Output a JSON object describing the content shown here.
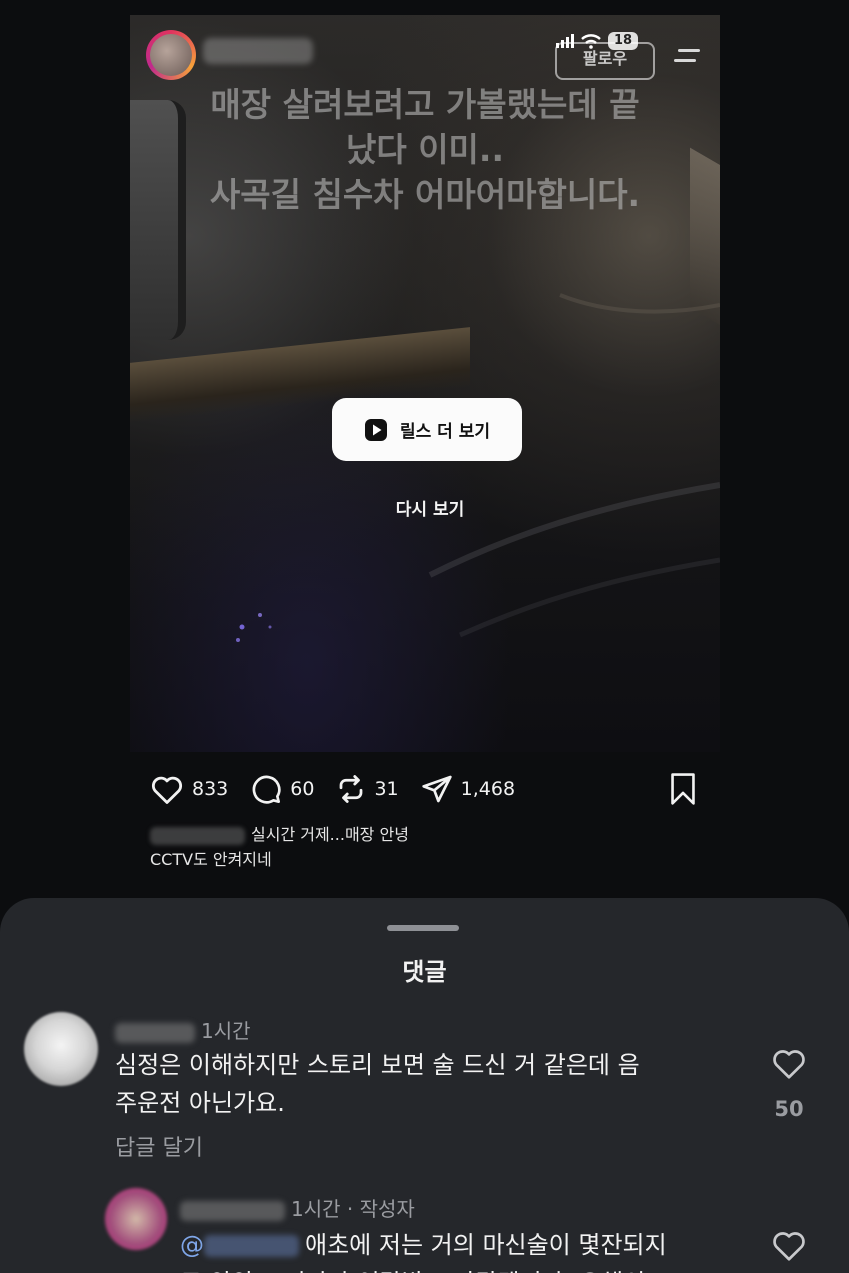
{
  "post": {
    "follow_label": "팔로우",
    "battery": "18",
    "overlay_text_line1": "매장 살려보려고 가볼랬는데 끝",
    "overlay_text_line2": "났다 이미..",
    "overlay_text_line3": "사곡길 침수차 어마어마합니다.",
    "reels_button_label": "릴스 더 보기",
    "replay_label": "다시 보기"
  },
  "actions": {
    "likes": "833",
    "comments": "60",
    "reposts": "31",
    "shares": "1,468"
  },
  "caption": {
    "line1": "실시간 거제...매장 안녕",
    "line2": "CCTV도 안켜지네"
  },
  "comments_sheet": {
    "title": "댓글",
    "comments": [
      {
        "time": "1시간",
        "text_line1": "심정은 이해하지만 스토리 보면 술 드신 거 같은데 음",
        "text_line2": "주운전 아닌가요.",
        "reply_label": "답글 달기",
        "like_count": "50"
      },
      {
        "time": "1시간 · 작성자",
        "mention_at": "@",
        "text_line1": "애초에 저는 거의 마신술이 몇잔되지",
        "text_line2": "도 않았고 지단과 연락받고 나갔겠니다. 오해의"
      }
    ]
  },
  "colors": {
    "background": "#0c0d0f",
    "sheet": "#25272b",
    "meta_text": "#9a9ca1",
    "mention": "#7fa6e8"
  }
}
